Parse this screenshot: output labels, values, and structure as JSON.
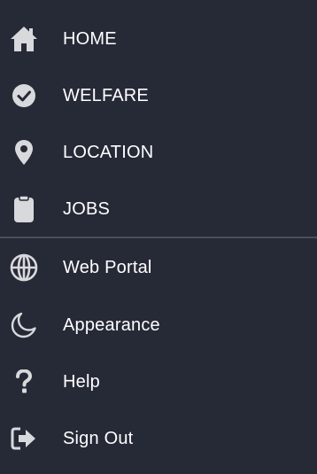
{
  "drawer": {
    "primary_items": [
      {
        "label": "HOME",
        "icon": "home-icon"
      },
      {
        "label": "WELFARE",
        "icon": "check-circle-icon"
      },
      {
        "label": "LOCATION",
        "icon": "location-pin-icon"
      },
      {
        "label": "JOBS",
        "icon": "clipboard-icon"
      }
    ],
    "secondary_items": [
      {
        "label": "Web Portal",
        "icon": "globe-icon"
      },
      {
        "label": "Appearance",
        "icon": "moon-icon"
      },
      {
        "label": "Help",
        "icon": "question-mark-icon"
      },
      {
        "label": "Sign Out",
        "icon": "sign-out-icon"
      }
    ]
  },
  "colors": {
    "background": "#262a37",
    "icon": "#d8d9dc",
    "text": "#ffffff",
    "divider": "#4a4e59"
  }
}
